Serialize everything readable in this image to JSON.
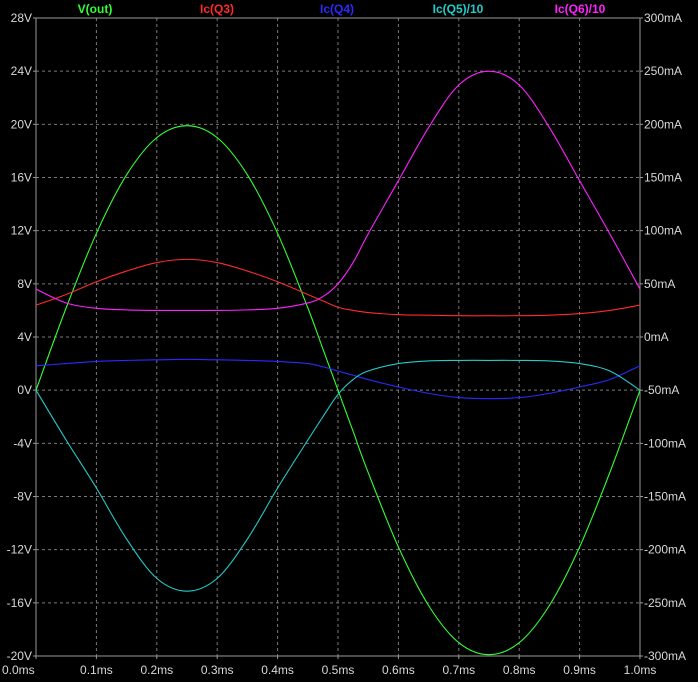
{
  "chart_data": {
    "type": "line",
    "x": [
      0,
      0.05,
      0.1,
      0.15,
      0.2,
      0.25,
      0.3,
      0.35,
      0.4,
      0.45,
      0.475,
      0.5,
      0.525,
      0.55,
      0.6,
      0.65,
      0.7,
      0.75,
      0.8,
      0.85,
      0.9,
      0.95,
      1.0
    ],
    "xlim": [
      0,
      1.0
    ],
    "x_ticks": [
      0,
      0.1,
      0.2,
      0.3,
      0.4,
      0.5,
      0.6,
      0.7,
      0.8,
      0.9,
      1.0
    ],
    "x_tick_labels": [
      "0.0ms",
      "0.1ms",
      "0.2ms",
      "0.3ms",
      "0.4ms",
      "0.5ms",
      "0.6ms",
      "0.7ms",
      "0.8ms",
      "0.9ms",
      "1.0ms"
    ],
    "ylim_left": [
      -20,
      28
    ],
    "y_ticks_left": [
      -20,
      -16,
      -12,
      -8,
      -4,
      0,
      4,
      8,
      12,
      16,
      20,
      24,
      28
    ],
    "y_tick_labels_left": [
      "-20V",
      "-16V",
      "-12V",
      "-8V",
      "-4V",
      "0V",
      "4V",
      "8V",
      "12V",
      "16V",
      "20V",
      "24V",
      "28V"
    ],
    "ylim_right": [
      -300,
      300
    ],
    "y_ticks_right": [
      -300,
      -250,
      -200,
      -150,
      -100,
      -50,
      0,
      50,
      100,
      150,
      200,
      250,
      300
    ],
    "y_tick_labels_right": [
      "-300mA",
      "-250mA",
      "-200mA",
      "-150mA",
      "-100mA",
      "-50mA",
      "0mA",
      "50mA",
      "100mA",
      "150mA",
      "200mA",
      "250mA",
      "300mA"
    ],
    "grid": true,
    "background": "#000000",
    "grid_color": "#7a7a7a",
    "series": [
      {
        "name": "V(out)",
        "axis": "left",
        "color": "#33ff33",
        "values": [
          0,
          6.2,
          11.8,
          16.2,
          19.0,
          19.9,
          19.0,
          16.2,
          11.8,
          6.2,
          3.1,
          0,
          -3.1,
          -6.2,
          -11.8,
          -16.2,
          -19.0,
          -19.9,
          -19.0,
          -16.2,
          -11.8,
          -6.2,
          0
        ]
      },
      {
        "name": "Ic(Q3)",
        "axis": "right",
        "color": "#ff2a2a",
        "values": [
          30,
          40,
          52,
          62,
          70,
          73,
          70,
          62,
          52,
          40,
          34,
          28,
          25,
          23,
          21,
          20.5,
          20,
          20,
          20,
          20.5,
          22,
          25,
          30
        ]
      },
      {
        "name": "Ic(Q4)",
        "axis": "right",
        "color": "#2a2aff",
        "values": [
          -27,
          -25,
          -23,
          -22,
          -21.5,
          -21,
          -21.5,
          -22,
          -23,
          -25,
          -28,
          -32,
          -36,
          -40,
          -47,
          -53,
          -57,
          -58,
          -57,
          -53,
          -47,
          -40,
          -27
        ]
      },
      {
        "name": "Ic(Q5)/10",
        "axis": "right",
        "color": "#22cccc",
        "values": [
          -50,
          -97,
          -142,
          -190,
          -227,
          -239,
          -227,
          -190,
          -142,
          -97,
          -75,
          -54,
          -40,
          -32,
          -25,
          -22.5,
          -22,
          -22,
          -22,
          -22.5,
          -25,
          -32,
          -50
        ]
      },
      {
        "name": "Ic(Q6)/10",
        "axis": "right",
        "color": "#ff22ff",
        "values": [
          45,
          32,
          27,
          25.5,
          25,
          25,
          25,
          25.5,
          27,
          32,
          38,
          50,
          70,
          97,
          147,
          197,
          237,
          250,
          237,
          197,
          147,
          97,
          45
        ]
      }
    ]
  }
}
